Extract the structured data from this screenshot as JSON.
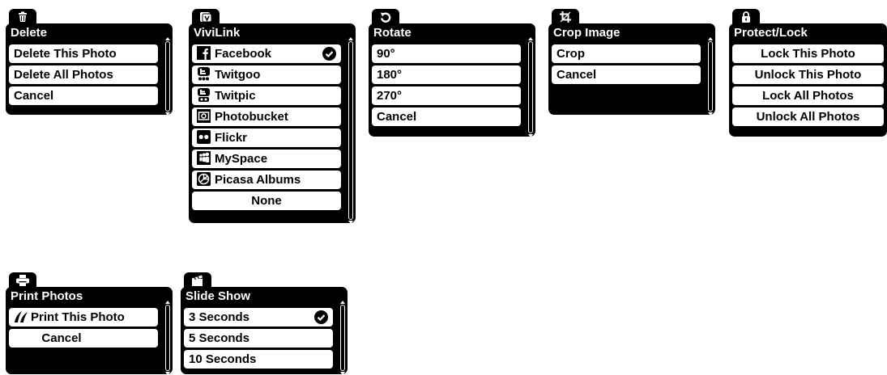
{
  "menus": {
    "delete": {
      "title": "Delete",
      "tab_icon": "trash-icon",
      "items": [
        "Delete This Photo",
        "Delete All Photos",
        "Cancel"
      ]
    },
    "vivilink": {
      "title": "ViviLink",
      "tab_icon": "vivilink-icon",
      "items": [
        "Facebook",
        "Twitgoo",
        "Twitpic",
        "Photobucket",
        "Flickr",
        "MySpace",
        "Picasa Albums",
        "None"
      ],
      "item_icons": [
        "facebook-icon",
        "twitgoo-icon",
        "twitpic-icon",
        "photobucket-icon",
        "flickr-icon",
        "myspace-icon",
        "picasa-icon"
      ],
      "selected": "Facebook"
    },
    "rotate": {
      "title": "Rotate",
      "tab_icon": "rotate-icon",
      "items": [
        "90°",
        "180°",
        "270°",
        "Cancel"
      ]
    },
    "crop": {
      "title": "Crop Image",
      "tab_icon": "crop-icon",
      "items": [
        "Crop",
        "Cancel"
      ]
    },
    "protect": {
      "title": "Protect/Lock",
      "tab_icon": "lock-icon",
      "items": [
        "Lock This Photo",
        "Unlock This Photo",
        "Lock All Photos",
        "Unlock All Photos"
      ]
    },
    "print": {
      "title": "Print Photos",
      "tab_icon": "printer-icon",
      "items": [
        "Print This Photo",
        "Cancel"
      ],
      "item_icons": [
        "pictbridge-icon"
      ]
    },
    "slideshow": {
      "title": "Slide Show",
      "tab_icon": "slideshow-icon",
      "items": [
        "3 Seconds",
        "5 Seconds",
        "10 Seconds"
      ],
      "selected": "3 Seconds"
    }
  },
  "colors": {
    "panel": "#000000",
    "item": "#ffffff",
    "text": "#000000"
  }
}
